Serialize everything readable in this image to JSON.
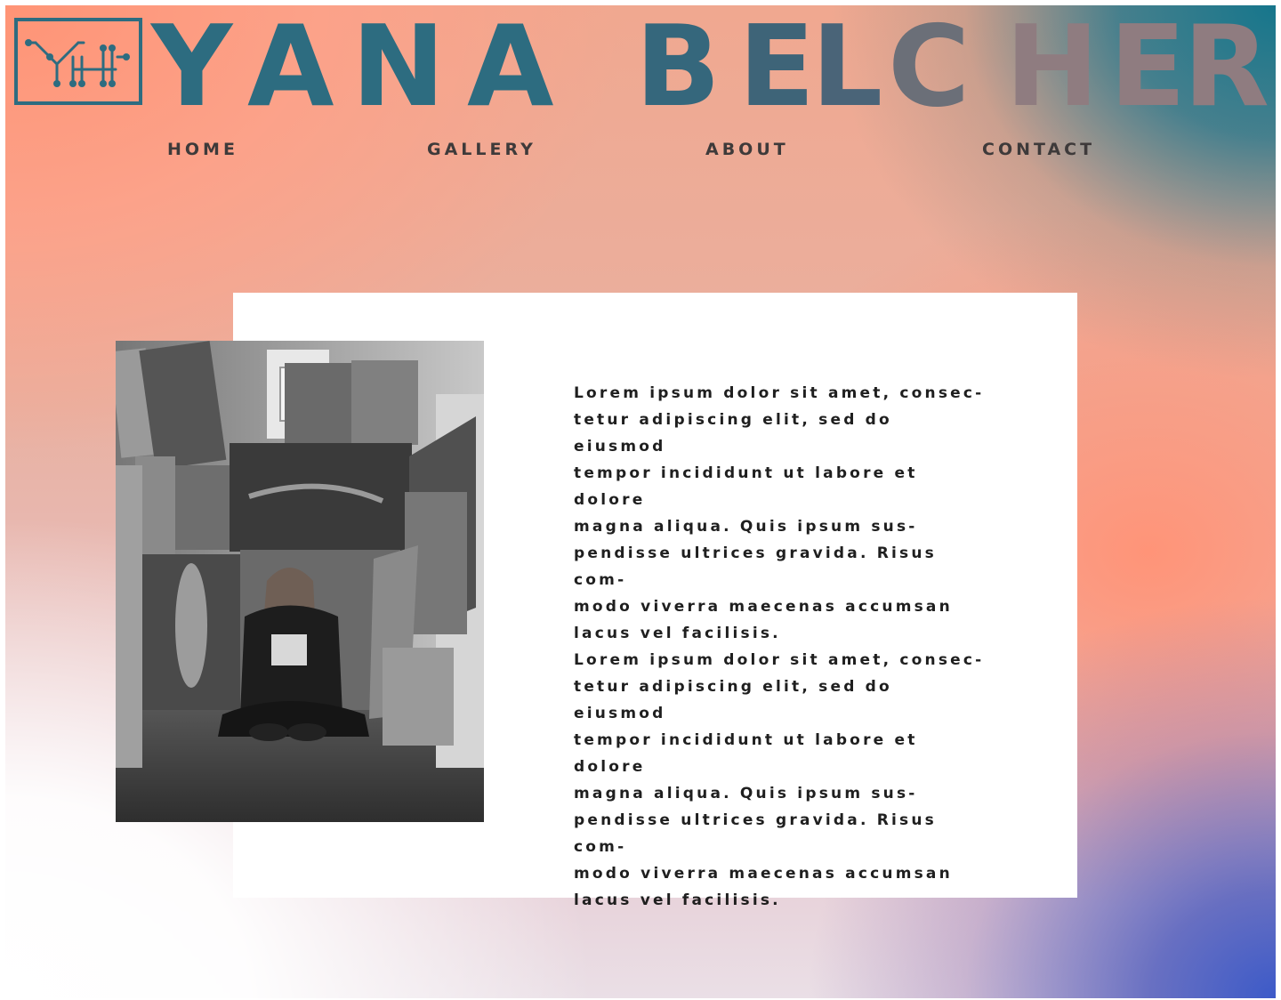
{
  "brand": {
    "name_letters": [
      "Y",
      "A",
      "N",
      "A",
      "B",
      "E",
      "L",
      "C",
      "H",
      "E",
      "R"
    ],
    "colors": {
      "primary": "#2d6c80",
      "fade_mid": "#6b6f78",
      "fade_light": "#8f7c80",
      "fade_end": "#1b7a8c"
    }
  },
  "logo": {
    "icon": "monogram-yh-circuit-icon",
    "color": "#2d6c80"
  },
  "nav": {
    "items": [
      "HOME",
      "GALLERY",
      "ABOUT",
      "CONTACT"
    ]
  },
  "about": {
    "photo_alt": "artist-sitting-among-paintings-photo",
    "paragraphs": [
      "Lorem ipsum dolor sit amet, consec-tetur adipiscing elit, sed do eiusmod tempor incididunt ut labore et dolore magna aliqua. Quis ipsum sus-pendisse ultrices gravida. Risus com-modo viverra maecenas accumsan lacus vel facilisis.",
      "Lorem ipsum dolor sit amet, consec-tetur adipiscing elit, sed do eiusmod tempor incididunt ut labore et dolore magna aliqua. Quis ipsum sus-pendisse ultrices gravida. Risus com-modo viverra maecenas accumsan lacus vel facilisis."
    ],
    "lines": [
      "Lorem ipsum dolor sit amet, consec-",
      "tetur adipiscing elit, sed do eiusmod",
      "tempor incididunt ut labore et dolore",
      "magna aliqua. Quis ipsum sus-",
      "pendisse ultrices gravida. Risus com-",
      "modo viverra maecenas accumsan",
      "lacus vel facilisis.",
      "Lorem ipsum dolor sit amet, consec-",
      "tetur adipiscing elit, sed do eiusmod",
      "tempor incididunt ut labore et dolore",
      "magna aliqua. Quis ipsum sus-",
      "pendisse ultrices gravida. Risus com-",
      "modo viverra maecenas accumsan",
      "lacus vel facilisis."
    ]
  },
  "colors": {
    "nav_text": "#3e3a3a",
    "body_text": "#1f1f1f",
    "card_bg": "#ffffff",
    "gradient_coral": "#ff9476",
    "gradient_teal": "#16768c",
    "gradient_blue": "#3c5ac8"
  }
}
